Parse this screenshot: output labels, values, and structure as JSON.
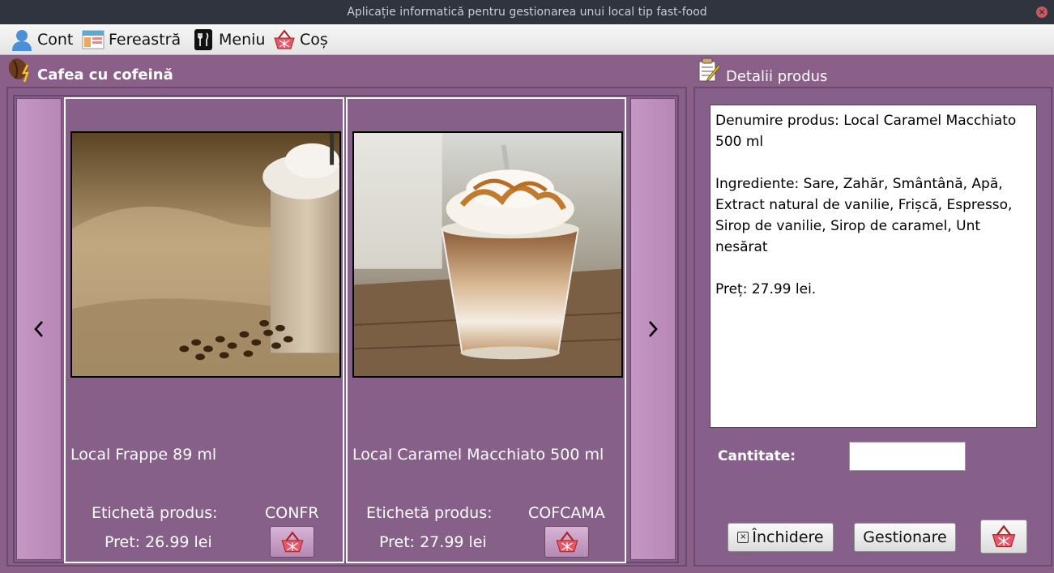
{
  "window": {
    "title": "Aplicație informatică pentru gestionarea unui local tip fast-food"
  },
  "menu": [
    {
      "label": "Cont",
      "icon": "user-icon"
    },
    {
      "label": "Fereastră",
      "icon": "window-icon"
    },
    {
      "label": "Meniu",
      "icon": "fork-knife-icon"
    },
    {
      "label": "Coș",
      "icon": "basket-icon"
    }
  ],
  "category": {
    "title": "Cafea cu cofeină",
    "icon": "coffee-bean-icon"
  },
  "details_panel": {
    "title": "Detalii produs",
    "icon": "notepad-icon"
  },
  "products": [
    {
      "name": "Local Frappe 89 ml",
      "tag_label": "Etichetă produs:",
      "code": "CONFR",
      "price": "Pret: 26.99 lei"
    },
    {
      "name": "Local Caramel Macchiato 500 ml",
      "tag_label": "Etichetă produs:",
      "code": "COFCAMA",
      "price": "Pret: 27.99 lei"
    }
  ],
  "details": {
    "text": "Denumire produs: Local Caramel Macchiato 500 ml\n\nIngrediente: Sare, Zahăr, Smântână, Apă, Extract natural de vanilie, Frișcă, Espresso, Sirop de vanilie, Sirop de caramel, Unt nesărat\n\nPreț: 27.99 lei.",
    "quantity_label": "Cantitate:",
    "quantity_value": ""
  },
  "buttons": {
    "close": "Închidere",
    "manage": "Gestionare"
  },
  "colors": {
    "background": "#8a6088",
    "nav_button": "#c497c4",
    "titlebar": "#2f343f"
  }
}
